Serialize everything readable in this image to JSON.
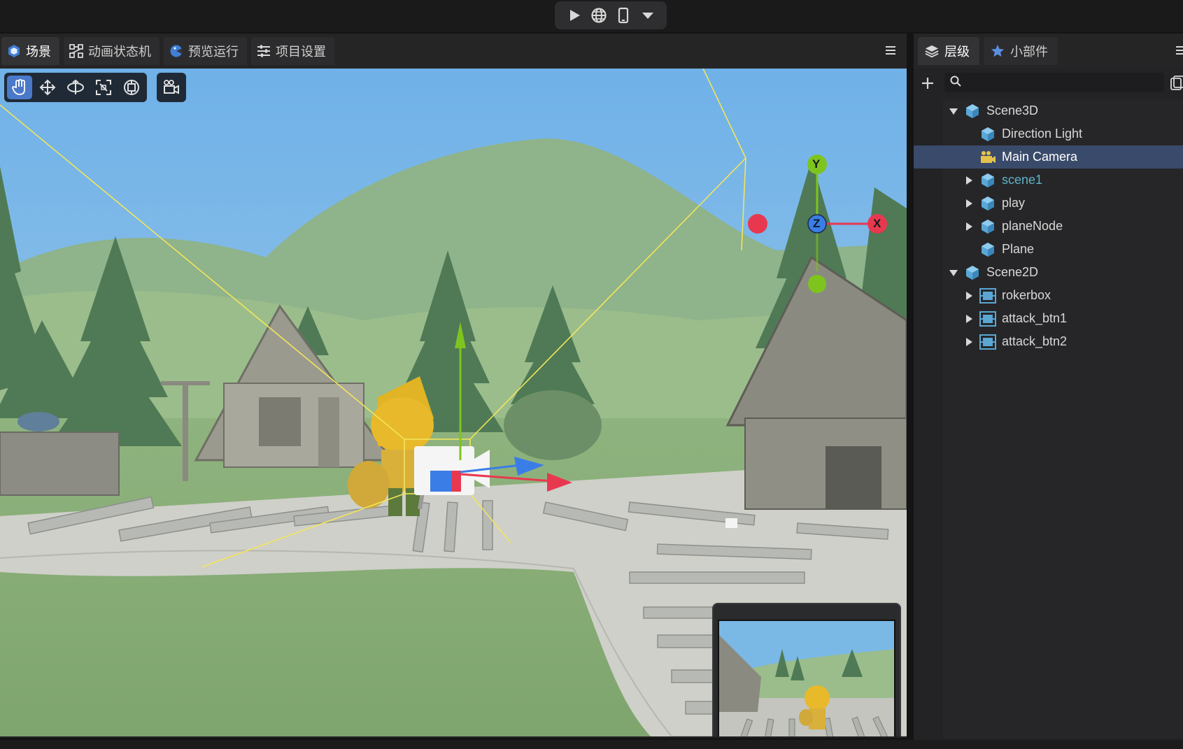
{
  "toolbar": {
    "play_icon": "play-icon",
    "web_icon": "globe-icon",
    "device_icon": "phone-icon",
    "dropdown_icon": "chevron-down-icon"
  },
  "scene_tabs": [
    {
      "label": "场景",
      "icon": "scene-icon",
      "active": true
    },
    {
      "label": "动画状态机",
      "icon": "state-machine-icon",
      "active": false
    },
    {
      "label": "预览运行",
      "icon": "preview-run-icon",
      "active": false
    },
    {
      "label": "项目设置",
      "icon": "settings-sliders-icon",
      "active": false
    }
  ],
  "scene_tools": [
    "hand-tool-icon",
    "move-tool-icon",
    "rotate-tool-icon",
    "scale-tool-icon",
    "rect-tool-icon",
    "camera-view-icon"
  ],
  "gizmo": {
    "x": "X",
    "y": "Y",
    "z": "Z"
  },
  "right_tabs": [
    {
      "label": "层级",
      "icon": "layers-icon",
      "active": true
    },
    {
      "label": "小部件",
      "icon": "star-icon",
      "active": false
    }
  ],
  "search": {
    "placeholder": "",
    "value": ""
  },
  "hierarchy": [
    {
      "label": "Scene3D",
      "depth": 0,
      "expand": "open",
      "icon": "cube-icon"
    },
    {
      "label": "Direction Light",
      "depth": 1,
      "expand": "none",
      "icon": "cube-icon"
    },
    {
      "label": "Main Camera",
      "depth": 1,
      "expand": "none",
      "icon": "camera-icon",
      "selected": true
    },
    {
      "label": "scene1",
      "depth": 1,
      "expand": "closed",
      "icon": "cube-icon",
      "highlight": true
    },
    {
      "label": "play",
      "depth": 1,
      "expand": "closed",
      "icon": "cube-icon"
    },
    {
      "label": "planeNode",
      "depth": 1,
      "expand": "closed",
      "icon": "cube-icon"
    },
    {
      "label": "Plane",
      "depth": 1,
      "expand": "none",
      "icon": "cube-icon"
    },
    {
      "label": "Scene2D",
      "depth": 0,
      "expand": "open",
      "icon": "cube-icon"
    },
    {
      "label": "rokerbox",
      "depth": 1,
      "expand": "closed",
      "icon": "sprite-box-icon"
    },
    {
      "label": "attack_btn1",
      "depth": 1,
      "expand": "closed",
      "icon": "sprite-box-icon"
    },
    {
      "label": "attack_btn2",
      "depth": 1,
      "expand": "closed",
      "icon": "sprite-box-icon"
    }
  ],
  "colors": {
    "accent": "#4a79c9",
    "selected_row": "#3a4a6a",
    "highlight_text": "#5fb3c9",
    "axis_x": "#e8384f",
    "axis_y": "#7ec41f",
    "axis_z": "#3b7de6"
  }
}
